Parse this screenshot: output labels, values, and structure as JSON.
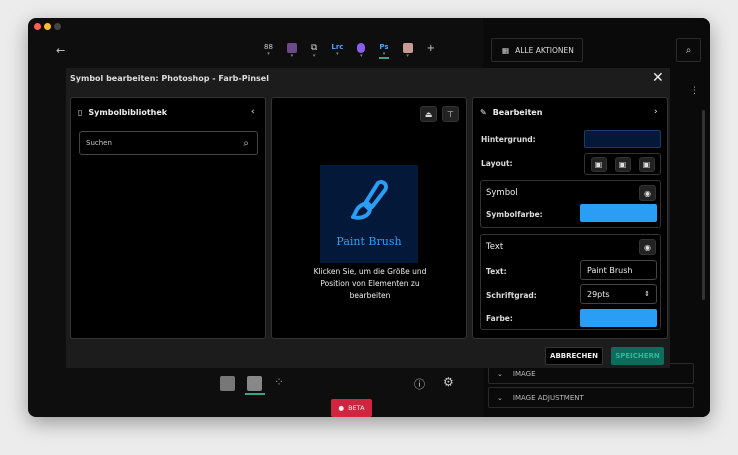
{
  "toolbar": {
    "back": "←",
    "apps": [
      "88",
      "Pr",
      "Ae",
      "Lrc",
      "Ae2",
      "Ps",
      "Ai"
    ],
    "add": "+",
    "all_actions": "ALLE AKTIONEN",
    "active_app": "Ps"
  },
  "modal": {
    "title": "Symbol bearbeiten: Photoshop - Farb-Pinsel",
    "library": {
      "title": "Symbolbibliothek",
      "search_placeholder": "Suchen"
    },
    "preview": {
      "icon_text": "Paint Brush",
      "hint": "Klicken Sie, um die Größe und Position von Elementen zu bearbeiten"
    },
    "edit": {
      "title": "Bearbeiten",
      "background_label": "Hintergrund:",
      "layout_label": "Layout:",
      "symbol_section": "Symbol",
      "symbol_color_label": "Symbolfarbe:",
      "text_section": "Text",
      "text_label": "Text:",
      "text_value": "Paint Brush",
      "size_label": "Schriftgrad:",
      "size_value": "29pts",
      "color_label": "Farbe:"
    },
    "cancel": "ABBRECHEN",
    "save": "SPEICHERN"
  },
  "sidebar": {
    "items": [
      "IMAGE",
      "IMAGE ADJUSTMENT"
    ]
  },
  "beta": "BETA",
  "colors": {
    "background": "#04193a",
    "symbol": "#2a9df4",
    "text": "#2a9df4",
    "save": "#0f6b5c",
    "beta": "#d0243f"
  }
}
